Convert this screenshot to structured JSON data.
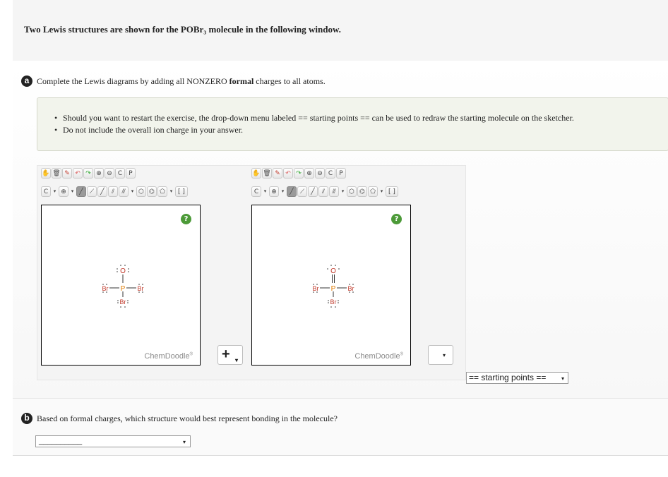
{
  "header": {
    "title": "Two Lewis structures are shown for the POBr₃ molecule in the following window."
  },
  "part_a": {
    "badge": "a",
    "question_pre": "Complete the Lewis diagrams by adding all NONZERO ",
    "question_bold": "formal",
    "question_post": " charges to all atoms.",
    "hints": [
      "Should you want to restart the exercise, the drop-down menu labeled == starting points == can be used to redraw the starting molecule on the sketcher.",
      "Do not include the overall ion charge in your answer."
    ]
  },
  "sketcher": {
    "toolbar_row1": [
      "hand-tool",
      "trash",
      "eraser",
      "undo",
      "redo",
      "zoom-in",
      "zoom-out",
      "clean",
      "paste"
    ],
    "clean_label": "C",
    "paste_label": "P",
    "element_label": "C",
    "bracket_label": "[ ]±",
    "help_label": "?",
    "brand": "ChemDoodle",
    "brand_mark": "®"
  },
  "molecule1": {
    "center": "P",
    "top": "O",
    "left": "Br",
    "right": "Br",
    "bottom": "Br",
    "top_bond": "single"
  },
  "molecule2": {
    "center": "P",
    "top": "O",
    "left": "Br",
    "right": "Br",
    "bottom": "Br",
    "top_bond": "double"
  },
  "controls": {
    "plus_label": "+",
    "dropdown_arrow": "▾",
    "blank_select_value": "",
    "starting_points_label": "== starting points =="
  },
  "part_b": {
    "badge": "b",
    "question": "Based on formal charges, which structure would best represent bonding in the molecule?",
    "select_value": "__________"
  },
  "colors": {
    "atom": "#c0392b",
    "p_atom": "#e07b00",
    "bond": "#333333",
    "help": "#4c9a38"
  }
}
